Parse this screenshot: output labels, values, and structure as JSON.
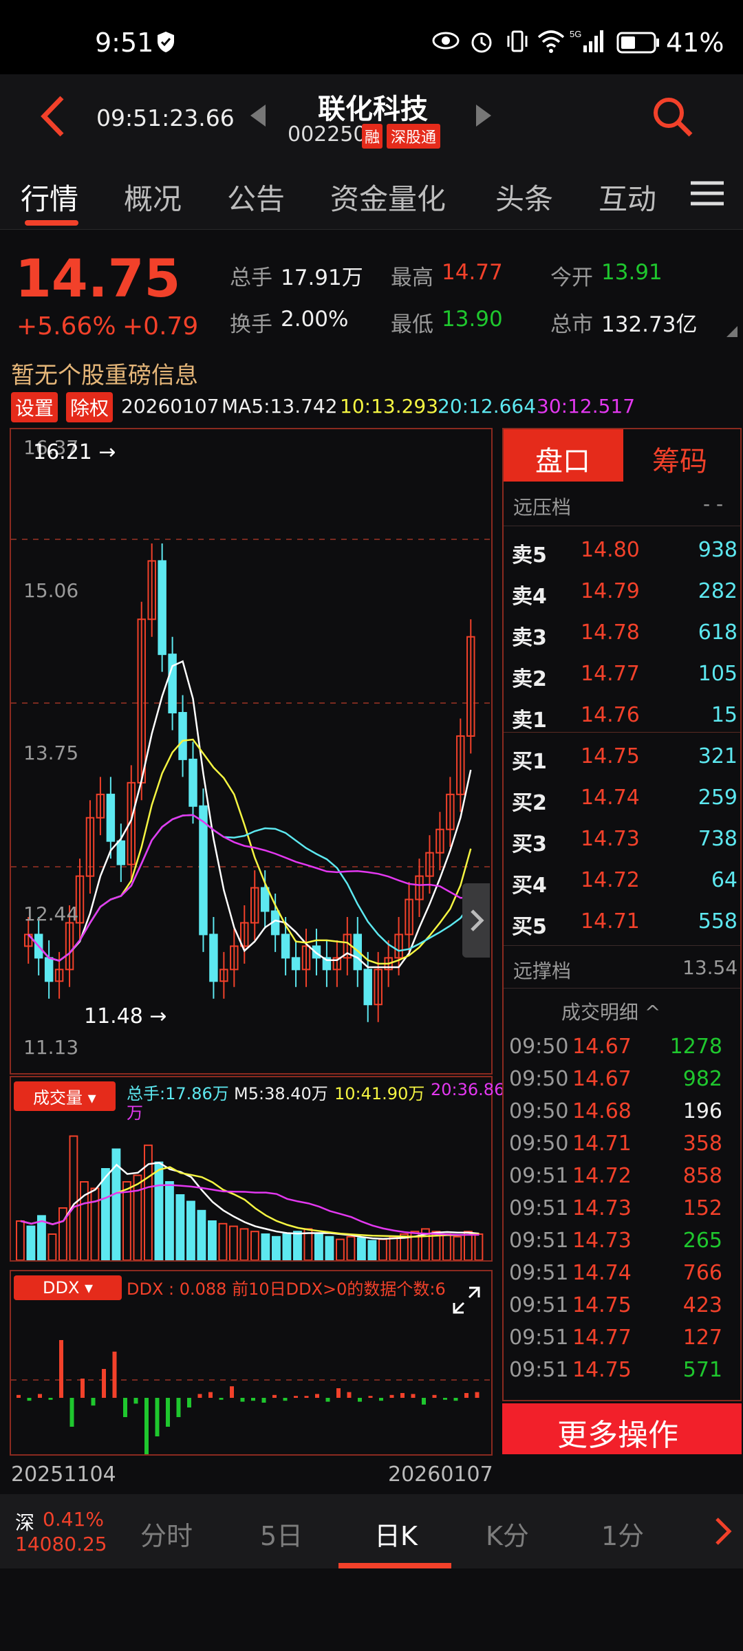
{
  "status": {
    "time": "9:51",
    "battery": "41%"
  },
  "nav": {
    "clock": "09:51:23.66",
    "name": "联化科技",
    "code": "002250",
    "badge_rong": "融",
    "badge_hk": "深股通"
  },
  "tabs": [
    "行情",
    "概况",
    "公告",
    "资金量化",
    "头条",
    "互动"
  ],
  "quote": {
    "price": "14.75",
    "pct": "+5.66%",
    "chg": "+0.79",
    "labels": {
      "vol": "总手",
      "turnover": "换手",
      "high": "最高",
      "low": "最低",
      "open": "今开",
      "mcap": "总市"
    },
    "vol": "17.91万",
    "turnover": "2.00%",
    "high": "14.77",
    "low": "13.90",
    "open": "13.91",
    "mcap": "132.73亿"
  },
  "notice": "暂无个股重磅信息",
  "ma": {
    "btn_settings": "设置",
    "btn_adjust": "除权",
    "date": "20260107",
    "ma5": "MA5:13.742",
    "ma10": "10:13.293",
    "ma20": "20:12.664",
    "ma30": "30:12.517"
  },
  "kline": {
    "y_top": "16.37",
    "y1": "15.06",
    "y2": "13.75",
    "y3": "12.44",
    "y_bottom": "11.13",
    "high_mark": "16.21 →",
    "low_mark": "11.48 →"
  },
  "volume": {
    "selector": "成交量 ▾",
    "total": "总手:17.86万",
    "ma5": "M5:38.40万",
    "ma10": "10:41.90万",
    "ma20": "20:36.86",
    "unit": "万"
  },
  "ddx": {
    "selector": "DDX ▾",
    "text": "DDX : 0.088 前10日DDX>0的数据个数:6"
  },
  "dates": {
    "start": "20251104",
    "end": "20260107"
  },
  "orderbook": {
    "tab_active": "盘口",
    "tab_other": "筹码",
    "far_pressure": "远压档",
    "far_pressure_val": "- -",
    "asks": [
      {
        "l": "卖5",
        "p": "14.80",
        "v": "938"
      },
      {
        "l": "卖4",
        "p": "14.79",
        "v": "282"
      },
      {
        "l": "卖3",
        "p": "14.78",
        "v": "618"
      },
      {
        "l": "卖2",
        "p": "14.77",
        "v": "105"
      },
      {
        "l": "卖1",
        "p": "14.76",
        "v": "15"
      }
    ],
    "bids": [
      {
        "l": "买1",
        "p": "14.75",
        "v": "321"
      },
      {
        "l": "买2",
        "p": "14.74",
        "v": "259"
      },
      {
        "l": "买3",
        "p": "14.73",
        "v": "738"
      },
      {
        "l": "买4",
        "p": "14.72",
        "v": "64"
      },
      {
        "l": "买5",
        "p": "14.71",
        "v": "558"
      }
    ],
    "far_support": "远撑档",
    "far_support_val": "13.54",
    "trades_title": "成交明细 ^",
    "trades": [
      {
        "t": "09:50",
        "p": "14.67",
        "v": "1278",
        "c": "#1fc72e"
      },
      {
        "t": "09:50",
        "p": "14.67",
        "v": "982",
        "c": "#1fc72e"
      },
      {
        "t": "09:50",
        "p": "14.68",
        "v": "196",
        "c": "#f0f0f0"
      },
      {
        "t": "09:50",
        "p": "14.71",
        "v": "358",
        "c": "#f2412a"
      },
      {
        "t": "09:51",
        "p": "14.72",
        "v": "858",
        "c": "#f2412a"
      },
      {
        "t": "09:51",
        "p": "14.73",
        "v": "152",
        "c": "#f2412a"
      },
      {
        "t": "09:51",
        "p": "14.73",
        "v": "265",
        "c": "#1fc72e"
      },
      {
        "t": "09:51",
        "p": "14.74",
        "v": "766",
        "c": "#f2412a"
      },
      {
        "t": "09:51",
        "p": "14.75",
        "v": "423",
        "c": "#f2412a"
      },
      {
        "t": "09:51",
        "p": "14.77",
        "v": "127",
        "c": "#f2412a"
      },
      {
        "t": "09:51",
        "p": "14.75",
        "v": "571",
        "c": "#1fc72e"
      }
    ],
    "more": "更多操作"
  },
  "bottom": {
    "index_name": "深",
    "index_pct": "0.41%",
    "index_val": "14080.25",
    "tabs": [
      "分时",
      "5日",
      "日K",
      "K分",
      "1分"
    ]
  },
  "colors": {
    "up": "#f2412a",
    "down": "#5de8f0",
    "ma5": "#ffffff",
    "ma10": "#f5f542",
    "ma20": "#5de8f0",
    "ma30": "#e338f0",
    "ddx_up": "#f2412a",
    "ddx_down": "#1fc72e"
  }
}
